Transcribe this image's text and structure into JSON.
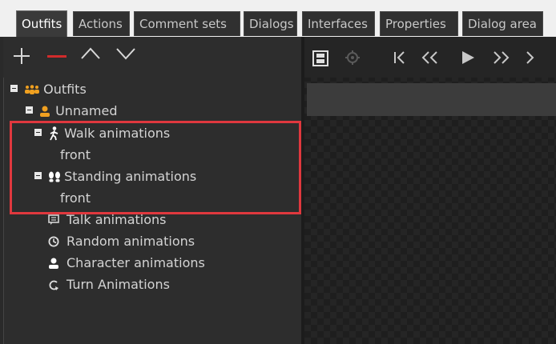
{
  "tabs": [
    {
      "label": "Outfits",
      "active": true
    },
    {
      "label": "Actions",
      "active": false
    },
    {
      "label": "Comment sets",
      "active": false
    },
    {
      "label": "Dialogs",
      "active": false
    },
    {
      "label": "Interfaces",
      "active": false
    },
    {
      "label": "Properties",
      "active": false
    },
    {
      "label": "Dialog area",
      "active": false
    }
  ],
  "tree": {
    "root": "Outfits",
    "character": "Unnamed",
    "walk": "Walk animations",
    "walk_child": "front",
    "standing": "Standing animations",
    "standing_child": "front",
    "talk": "Talk animations",
    "random": "Random animations",
    "character_anim": "Character animations",
    "turn": "Turn Animations"
  },
  "colors": {
    "accent_orange": "#f0a020",
    "highlight_red": "#e0383e",
    "remove_red": "#d12b2b"
  },
  "icons": {
    "add": "plus-icon",
    "remove": "minus-icon",
    "up": "chevron-up-icon",
    "down": "chevron-down-icon",
    "film": "film-icon",
    "settings": "gear-icon",
    "first": "skip-first-icon",
    "rewind": "rewind-icon",
    "play": "play-icon",
    "forward": "fast-forward-icon",
    "last": "skip-last-icon"
  }
}
